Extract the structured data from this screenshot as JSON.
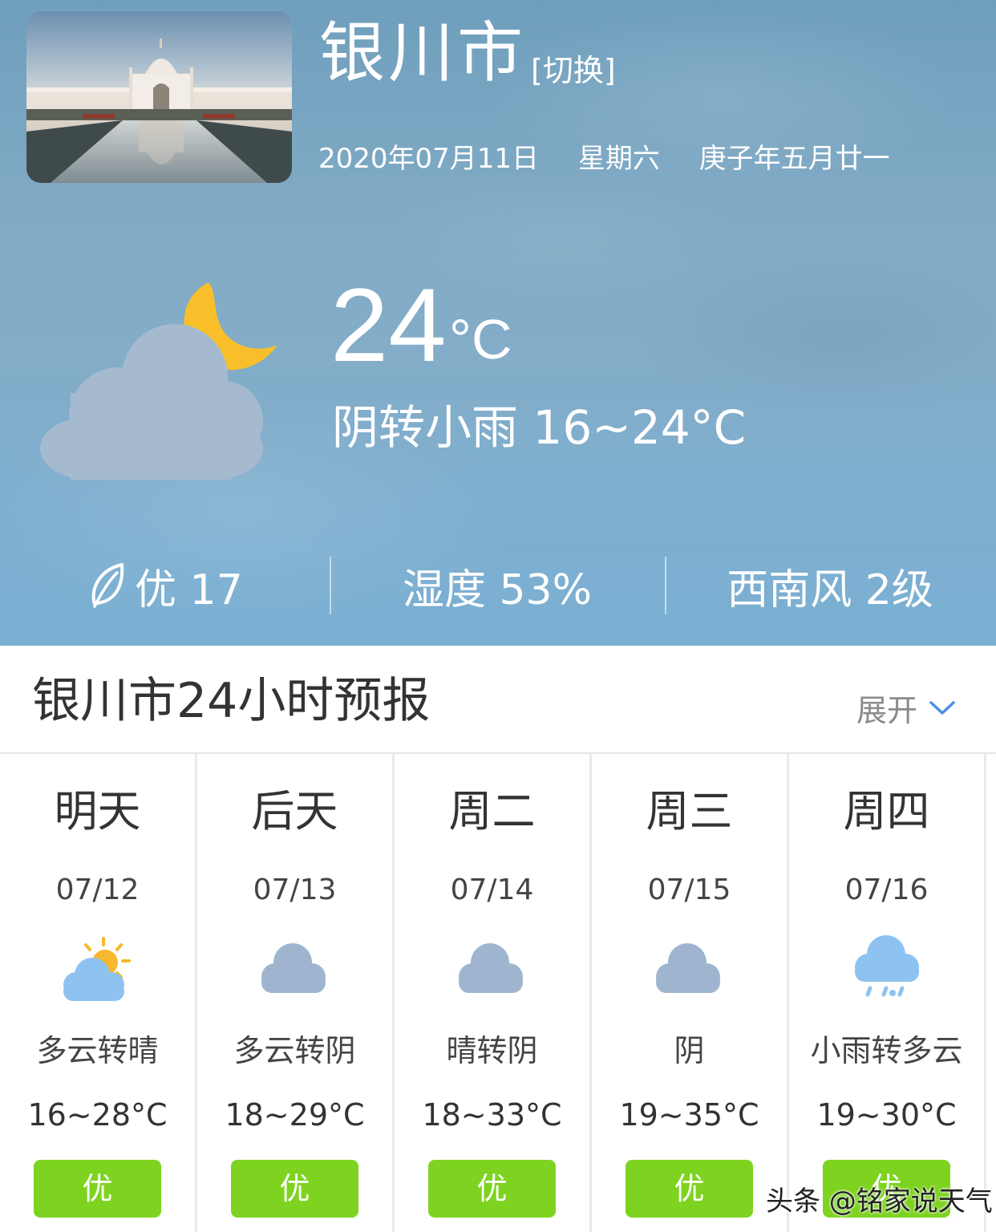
{
  "header": {
    "city": "银川市",
    "switch_label": "[切换]",
    "date": "2020年07月11日",
    "weekday": "星期六",
    "lunar": "庚子年五月廿一"
  },
  "current": {
    "temperature": "24",
    "unit": "°C",
    "description": "阴转小雨 16~24°C",
    "icon": "cloudy-night-moon-icon"
  },
  "stats": {
    "aqi": "优 17",
    "humidity": "湿度 53%",
    "wind": "西南风 2级"
  },
  "forecast_section": {
    "title": "银川市24小时预报",
    "expand_label": "展开"
  },
  "days": [
    {
      "name": "明天",
      "date": "07/12",
      "icon": "partly-sunny-icon",
      "desc": "多云转晴",
      "temp": "16~28°C",
      "aqi": "优"
    },
    {
      "name": "后天",
      "date": "07/13",
      "icon": "cloud-icon",
      "desc": "多云转阴",
      "temp": "18~29°C",
      "aqi": "优"
    },
    {
      "name": "周二",
      "date": "07/14",
      "icon": "cloud-icon",
      "desc": "晴转阴",
      "temp": "18~33°C",
      "aqi": "优"
    },
    {
      "name": "周三",
      "date": "07/15",
      "icon": "cloud-icon",
      "desc": "阴",
      "temp": "19~35°C",
      "aqi": "优"
    },
    {
      "name": "周四",
      "date": "07/16",
      "icon": "rain-cloud-icon",
      "desc": "小雨转多云",
      "temp": "19~30°C",
      "aqi": "优"
    }
  ],
  "watermark": "头条 @铭家说天气",
  "colors": {
    "aqi_good": "#7ed321",
    "moon": "#f8bf2a",
    "cloud_big": "#a6bacf",
    "cloud_small": "#9fb5cf",
    "cloud_blue": "#8ec2f0"
  }
}
